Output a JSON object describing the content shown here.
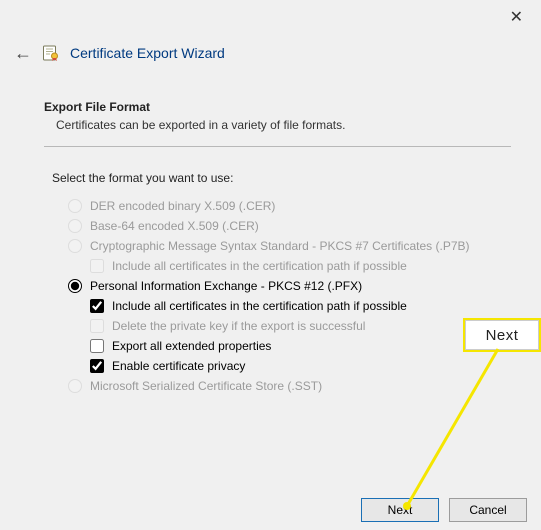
{
  "title": "Certificate Export Wizard",
  "heading": "Export File Format",
  "subtext": "Certificates can be exported in a variety of file formats.",
  "prompt": "Select the format you want to use:",
  "options": [
    {
      "label": "DER encoded binary X.509 (.CER)",
      "enabled": false
    },
    {
      "label": "Base-64 encoded X.509 (.CER)",
      "enabled": false
    },
    {
      "label": "Cryptographic Message Syntax Standard - PKCS #7 Certificates (.P7B)",
      "enabled": false,
      "sub": [
        {
          "label": "Include all certificates in the certification path if possible",
          "enabled": false,
          "checked": false
        }
      ]
    },
    {
      "label": "Personal Information Exchange - PKCS #12 (.PFX)",
      "enabled": true,
      "selected": true,
      "sub": [
        {
          "label": "Include all certificates in the certification path if possible",
          "enabled": true,
          "checked": true
        },
        {
          "label": "Delete the private key if the export is successful",
          "enabled": false,
          "checked": false
        },
        {
          "label": "Export all extended properties",
          "enabled": true,
          "checked": false
        },
        {
          "label": "Enable certificate privacy",
          "enabled": true,
          "checked": true
        }
      ]
    },
    {
      "label": "Microsoft Serialized Certificate Store (.SST)",
      "enabled": false
    }
  ],
  "buttons": {
    "next": "Next",
    "cancel": "Cancel"
  },
  "callout": "Next"
}
